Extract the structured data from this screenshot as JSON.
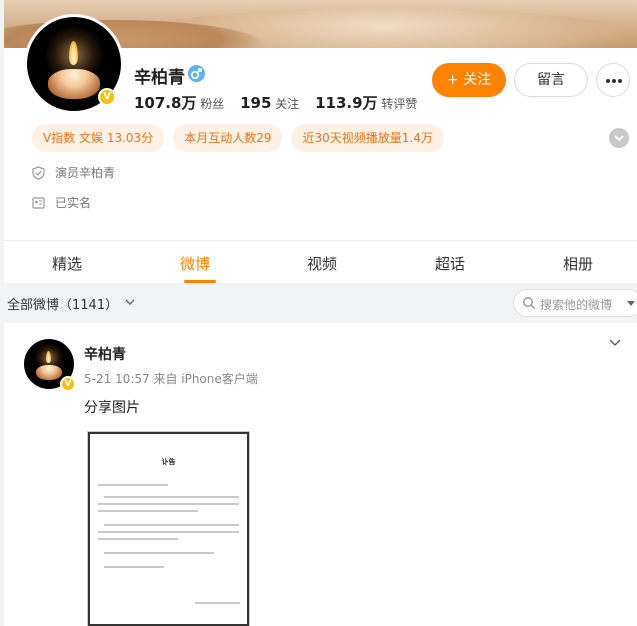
{
  "profile": {
    "name": "辛柏青",
    "verified_badge": "V",
    "gender_icon": "male-icon",
    "stats": [
      {
        "value": "107.8万",
        "label": "粉丝"
      },
      {
        "value": "195",
        "label": "关注"
      },
      {
        "value": "113.9万",
        "label": "转评赞"
      }
    ],
    "actions": {
      "follow_label": "+ 关注",
      "message_label": "留言"
    },
    "tags": [
      "V指数 文娱 13.03分",
      "本月互动人数29",
      "近30天视频播放量1.4万"
    ],
    "info": [
      {
        "icon": "verified-shield-icon",
        "text": "演员辛柏青"
      },
      {
        "icon": "id-card-icon",
        "text": "已实名"
      }
    ]
  },
  "tabs": [
    {
      "label": "精选",
      "active": false
    },
    {
      "label": "微博",
      "active": true
    },
    {
      "label": "视频",
      "active": false
    },
    {
      "label": "超话",
      "active": false
    },
    {
      "label": "相册",
      "active": false
    }
  ],
  "filter": {
    "label": "全部微博（1141）",
    "search_placeholder": "搜索他的微博"
  },
  "post": {
    "author": "辛柏青",
    "meta": "5-21 10:57 来自 iPhone客户端",
    "text": "分享图片",
    "doc_title": "讣告"
  },
  "colors": {
    "accent": "#ff8200",
    "tag_bg": "#fdf0e4",
    "tag_text": "#e87420",
    "verified": "#f6c20c",
    "male": "#5fb3f0"
  }
}
